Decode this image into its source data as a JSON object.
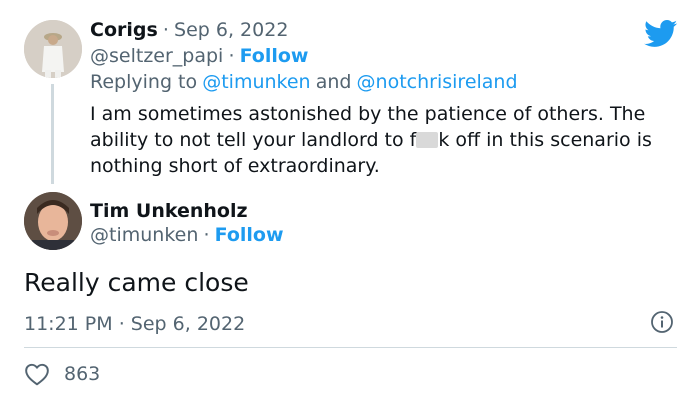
{
  "reply_tweet": {
    "display_name": "Corigs",
    "separator": "·",
    "date": "Sep 6, 2022",
    "handle": "@seltzer_papi",
    "follow_label": "Follow",
    "replying_to_prefix": "Replying to",
    "replying_to_user1": "@timunken",
    "replying_to_and": "and",
    "replying_to_user2": "@notchrisireland",
    "text_line1": "I am sometimes astonished by the patience of others. The",
    "text_line2_before": "ability to not tell your landlord to f",
    "text_line2_after": "k off in this scenario is",
    "text_line3": "nothing short of extraordinary."
  },
  "main_tweet": {
    "display_name": "Tim Unkenholz",
    "handle": "@timunken",
    "separator": "·",
    "follow_label": "Follow",
    "text": "Really came close",
    "time": "11:21 PM",
    "date": "Sep 6, 2022",
    "likes_count": "863"
  },
  "icons": {
    "brand": "twitter-bird-icon",
    "info": "info-icon",
    "like": "heart-icon"
  },
  "colors": {
    "accent": "#1d9bf0",
    "muted": "#536471",
    "text": "#0f1419",
    "divider": "#cfd9de"
  }
}
